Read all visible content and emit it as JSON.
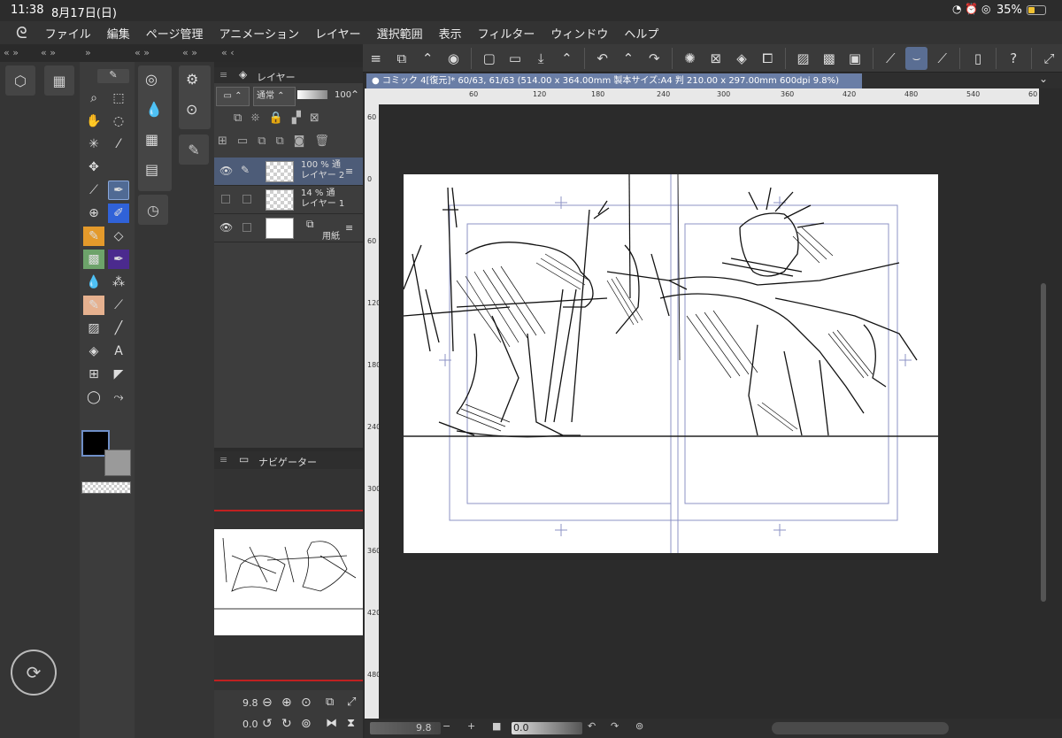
{
  "status": {
    "time": "11:38",
    "date": "8月17日(日)",
    "battery": "35%"
  },
  "menu": [
    "ファイル",
    "編集",
    "ページ管理",
    "アニメーション",
    "レイヤー",
    "選択範囲",
    "表示",
    "フィルター",
    "ウィンドウ",
    "ヘルプ"
  ],
  "document": {
    "title": "コミック 4[復元]* 60/63, 61/63 (514.00 x 364.00mm 製本サイズ:A4 判 210.00 x 297.00mm 600dpi 9.8%)"
  },
  "ruler": {
    "h": [
      "60",
      "120",
      "180",
      "240",
      "300",
      "360",
      "420",
      "480",
      "540",
      "60"
    ],
    "v": [
      "60",
      "0",
      "60",
      "120",
      "180",
      "240",
      "300",
      "360",
      "420",
      "480"
    ]
  },
  "layers": {
    "panel_title": "レイヤー",
    "blend_mode": "通常",
    "opacity": "100",
    "items": [
      {
        "opacity": "100 %",
        "mode": "通",
        "name": "レイヤー 2"
      },
      {
        "opacity": "14 %",
        "mode": "通",
        "name": "レイヤー 1"
      },
      {
        "opacity": "",
        "mode": "",
        "name": "用紙"
      }
    ]
  },
  "navigator": {
    "title": "ナビゲーター",
    "zoom": "9.8",
    "rotation": "0.0"
  },
  "bottom_bar": {
    "zoom": "9.8",
    "rotation": "0.0"
  },
  "colors": {
    "accent": "#5a6e93",
    "main_color": "#000000",
    "sub_color": "#9a9a9a"
  }
}
